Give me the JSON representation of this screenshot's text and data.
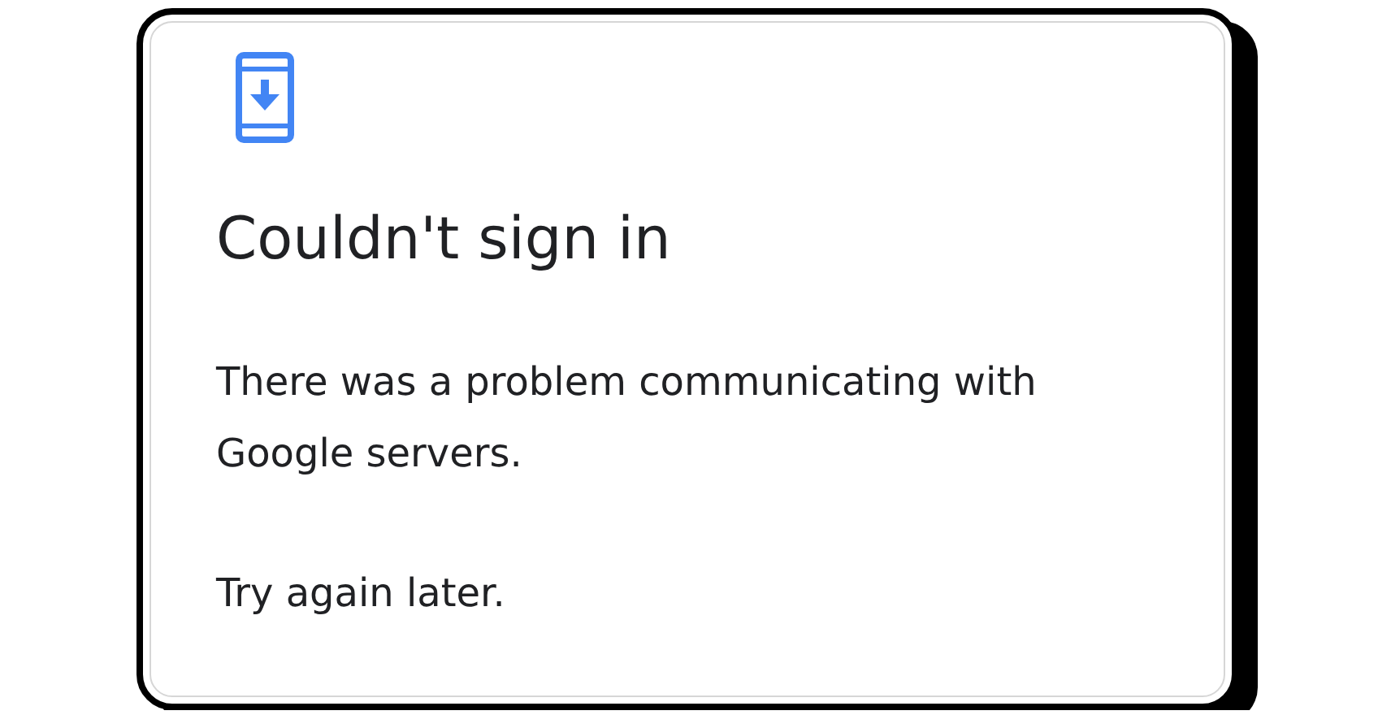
{
  "dialog": {
    "title": "Couldn't sign in",
    "paragraphs": [
      "There was a problem communicating with Google servers.",
      "Try again later."
    ]
  }
}
